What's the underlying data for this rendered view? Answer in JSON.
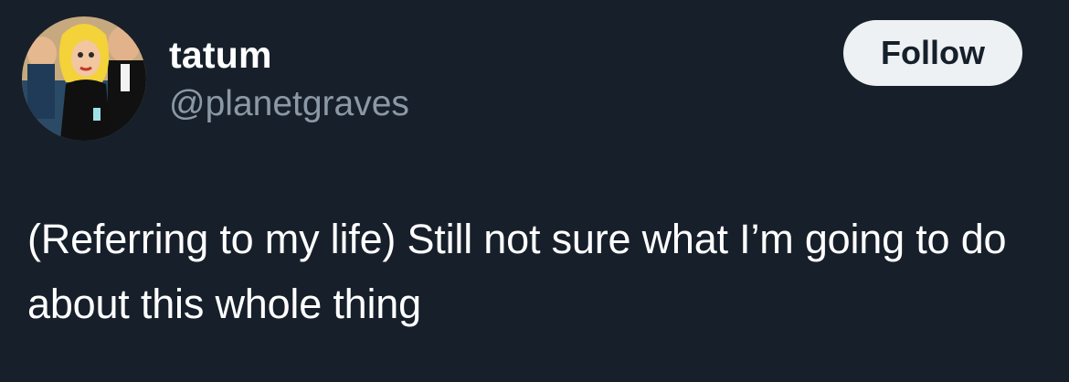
{
  "user": {
    "display_name": "tatum",
    "handle": "@planetgraves"
  },
  "follow_button": {
    "label": "Follow"
  },
  "tweet": {
    "text": "(Referring to my life) Still not sure what I’m going to do about this whole thing"
  },
  "colors": {
    "background": "#17202a",
    "text_primary": "#ffffff",
    "text_secondary": "#8b98a5",
    "button_background": "#eef1f3",
    "button_text": "#15202b"
  }
}
